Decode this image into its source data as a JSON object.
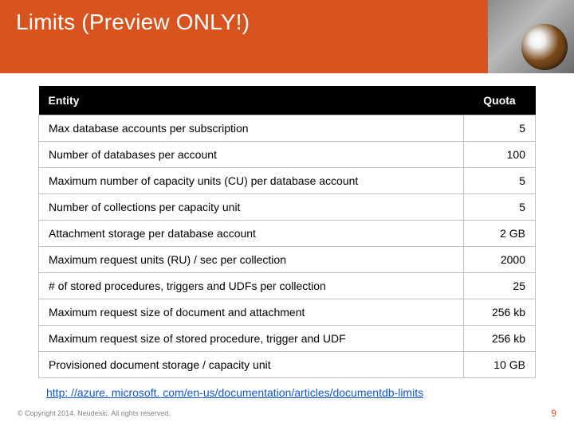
{
  "title": "Limits (Preview ONLY!)",
  "table": {
    "headers": {
      "entity": "Entity",
      "quota": "Quota"
    },
    "rows": [
      {
        "entity": "Max database accounts per subscription",
        "quota": "5"
      },
      {
        "entity": "Number of databases per account",
        "quota": "100"
      },
      {
        "entity": "Maximum number of capacity units (CU) per database account",
        "quota": "5"
      },
      {
        "entity": "Number of collections per capacity unit",
        "quota": "5"
      },
      {
        "entity": "Attachment storage per database account",
        "quota": "2 GB"
      },
      {
        "entity": "Maximum request units (RU) / sec per collection",
        "quota": "2000"
      },
      {
        "entity": "# of stored procedures, triggers and UDFs per collection",
        "quota": "25"
      },
      {
        "entity": "Maximum request size of document and attachment",
        "quota": "256 kb"
      },
      {
        "entity": "Maximum request size of stored procedure, trigger and UDF",
        "quota": "256 kb"
      },
      {
        "entity": "Provisioned document storage / capacity unit",
        "quota": "10 GB"
      }
    ]
  },
  "link": {
    "text": "http: //azure. microsoft. com/en-us/documentation/articles/documentdb-limits"
  },
  "footer": {
    "copyright": "© Copyright 2014. Neudesic. All rights reserved.",
    "page": "9"
  }
}
